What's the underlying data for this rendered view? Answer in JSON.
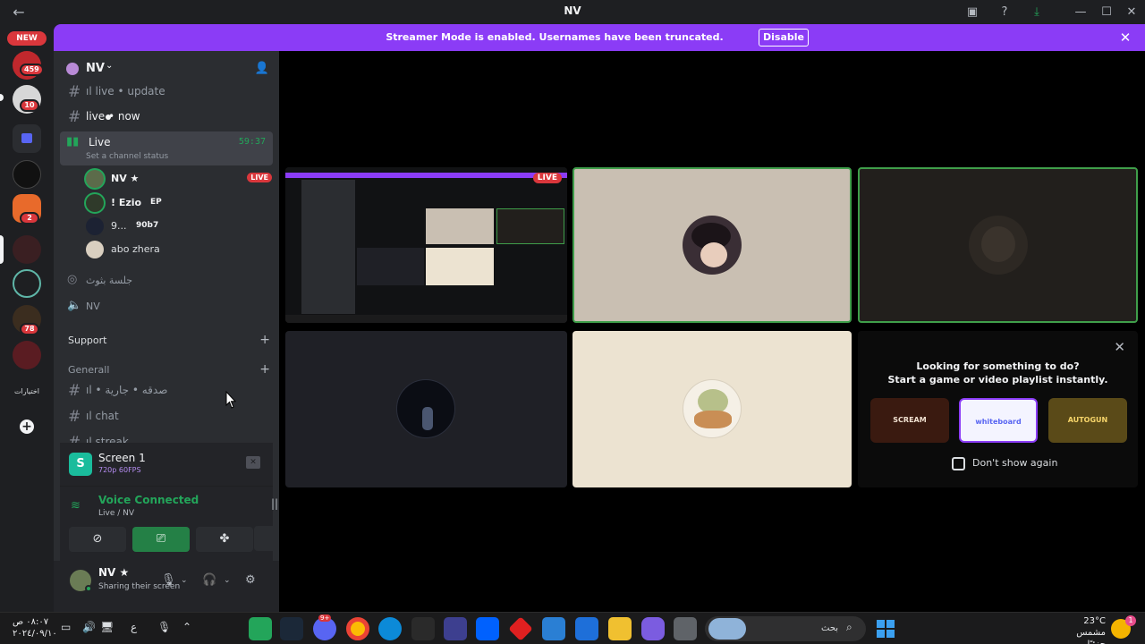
{
  "window": {
    "title": "NV"
  },
  "titlebar": {
    "back_icon": "arrow-left-icon",
    "icons": [
      "inbox-icon",
      "help-icon",
      "download-icon",
      "minimize-icon",
      "maximize-icon",
      "close-icon"
    ]
  },
  "rail": {
    "new_label": "NEW",
    "badges": [
      "459",
      "10",
      "2",
      "78"
    ],
    "bottom_label": "اختيارات",
    "add_server": "+"
  },
  "banner": {
    "text": "Streamer Mode is enabled. Usernames have been truncated.",
    "button": "Disable"
  },
  "guild": {
    "name": "NV"
  },
  "channels": {
    "live_update": "ıl live • update",
    "live_now": "live • now"
  },
  "voice_channel": {
    "name": "Live",
    "time": "59:37",
    "status_placeholder": "Set a channel status",
    "users": [
      {
        "name": "NV ★",
        "live": "LIVE"
      },
      {
        "name": "! Ezio",
        "tag": "EP"
      },
      {
        "name": "9...",
        "tag": "90b7"
      },
      {
        "name": "abo zhera"
      }
    ]
  },
  "stage_channels": [
    {
      "name": "جلسة بثوث"
    },
    {
      "name": "NV"
    }
  ],
  "categories": {
    "support": "Support",
    "general": "Generall"
  },
  "text_channels": [
    {
      "name": "ıl • صدقه • جارية"
    },
    {
      "name": "ıl chat"
    },
    {
      "name": "ıl streak"
    }
  ],
  "stream_panel": {
    "title": "Screen 1",
    "quality": "720p 60FPS",
    "icon_letter": "S"
  },
  "voice_panel": {
    "title": "Voice Connected",
    "location": "Live / NV"
  },
  "user_panel": {
    "name": "NV ★",
    "status": "Sharing their screen"
  },
  "stage": {
    "live_badge": "LIVE",
    "activity": {
      "title": "Looking for something to do?",
      "subtitle": "Start a game or video playlist instantly.",
      "cards": [
        "SCREAM",
        "whiteboard",
        "AUTOGUN"
      ],
      "checkbox_label": "Don't show again"
    }
  },
  "taskbar": {
    "clock_time": "٠٨:٠٧ ص",
    "clock_date": "٢٠٢٤/٠٩/١٠",
    "lang": "ع",
    "search_placeholder": "بحث",
    "weather_temp": "23°C",
    "weather_desc": "مشمس جزئيًا",
    "discord_badge": "9+",
    "weather_badge": "1"
  },
  "colors": {
    "accent_purple": "#8b3cf6",
    "online_green": "#23a55a",
    "live_red": "#da373c"
  }
}
